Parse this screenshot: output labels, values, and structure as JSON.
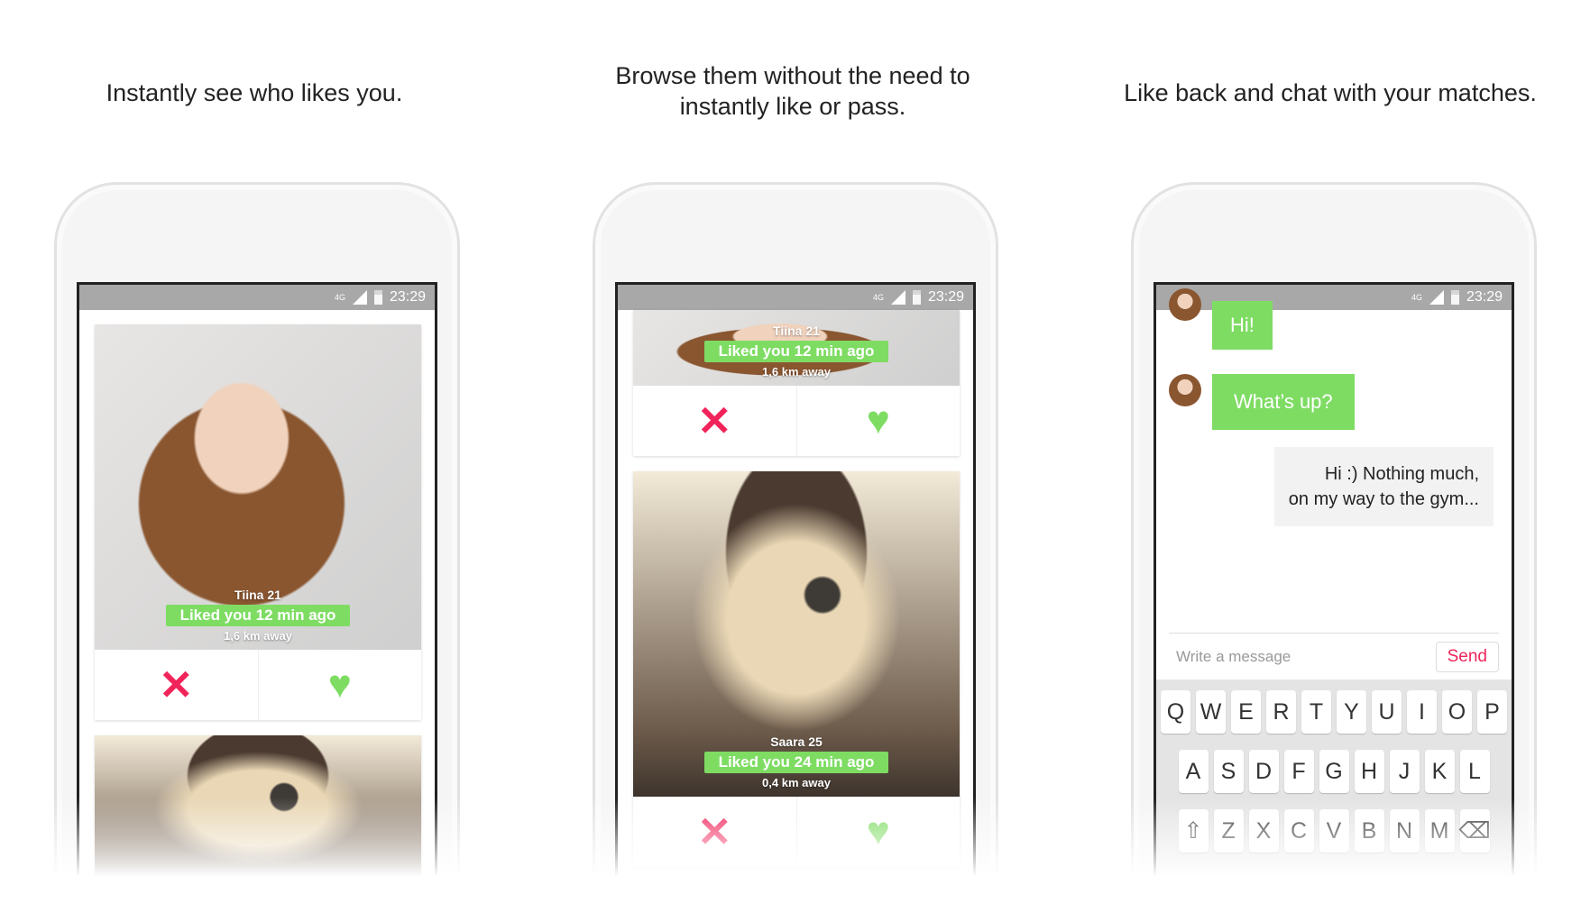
{
  "captions": [
    "Instantly see who likes you.",
    "Browse them without the need to instantly like or pass.",
    "Like back and chat with your matches."
  ],
  "status": {
    "network": "4G",
    "time": "23:29"
  },
  "profiles": [
    {
      "name": "Tiina 21",
      "liked": "Liked you 12 min ago",
      "distance": "1,6 km away"
    },
    {
      "name": "Saara 25",
      "liked": "Liked you 24 min ago",
      "distance": "0,4 km away"
    }
  ],
  "chat": {
    "messages": [
      {
        "from": "them",
        "text": "Hi!"
      },
      {
        "from": "them",
        "text": "What’s up?"
      },
      {
        "from": "me",
        "line1": "Hi :) Nothing much,",
        "line2": "on my way to the gym..."
      }
    ],
    "input_placeholder": "Write a message",
    "send_label": "Send"
  },
  "keyboard": {
    "row1": [
      "Q",
      "W",
      "E",
      "R",
      "T",
      "Y",
      "U",
      "I",
      "O",
      "P"
    ],
    "row2": [
      "A",
      "S",
      "D",
      "F",
      "G",
      "H",
      "J",
      "K",
      "L"
    ],
    "row3": [
      "⇧",
      "Z",
      "X",
      "C",
      "V",
      "B",
      "N",
      "M",
      "⌫"
    ]
  },
  "colors": {
    "accent_green": "#7edc63",
    "accent_red": "#f0245a"
  }
}
